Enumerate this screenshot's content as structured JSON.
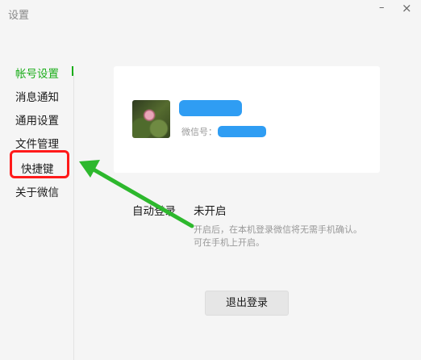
{
  "window": {
    "title": "设置",
    "minimize_glyph": "–",
    "close_glyph": "×"
  },
  "sidebar": {
    "items": [
      {
        "label": "帐号设置",
        "active": true
      },
      {
        "label": "消息通知",
        "active": false
      },
      {
        "label": "通用设置",
        "active": false
      },
      {
        "label": "文件管理",
        "active": false
      },
      {
        "label": "快捷键",
        "active": false
      },
      {
        "label": "关于微信",
        "active": false
      }
    ]
  },
  "account": {
    "wechat_id_label": "微信号："
  },
  "auto_login": {
    "label": "自动登录",
    "value": "未开启",
    "hint_line1": "开启后，在本机登录微信将无需手机确认。",
    "hint_line2": "可在手机上开启。"
  },
  "logout_button": {
    "label": "退出登录"
  },
  "colors": {
    "accent": "#1aad19",
    "annotation_red": "#ff1a1a",
    "annotation_green": "#2db82d",
    "redaction_blue": "#2f9df3"
  }
}
